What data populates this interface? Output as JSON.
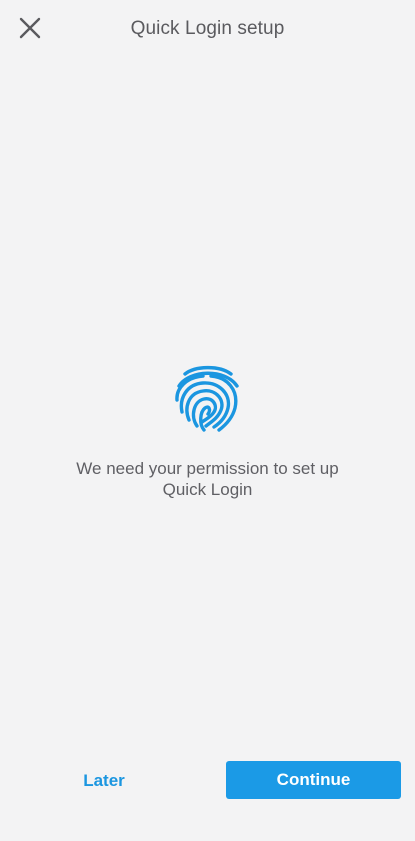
{
  "header": {
    "title": "Quick Login setup",
    "close_icon": "close-icon"
  },
  "main": {
    "icon": "fingerprint-icon",
    "message": "We need your permission to set up Quick Login"
  },
  "actions": {
    "later_label": "Later",
    "continue_label": "Continue"
  },
  "colors": {
    "accent": "#1b9ae6",
    "background": "#f3f3f4",
    "text": "#5f5f64"
  }
}
